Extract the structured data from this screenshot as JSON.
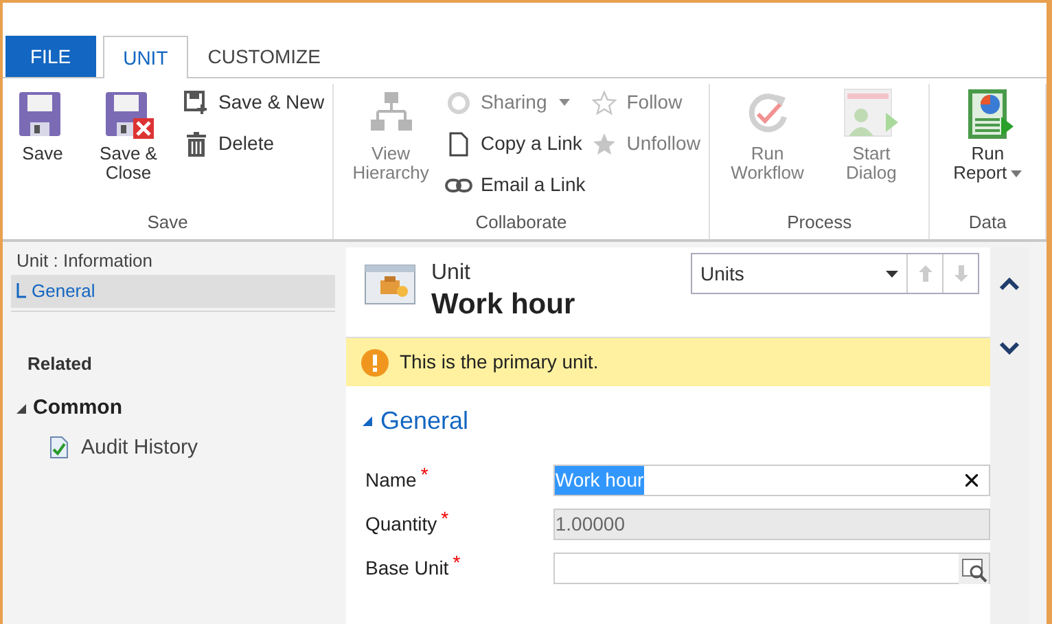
{
  "tabs": [
    {
      "label": "FILE",
      "kind": "file",
      "selected": false
    },
    {
      "label": "UNIT",
      "kind": "tab",
      "selected": true
    },
    {
      "label": "CUSTOMIZE",
      "kind": "tab",
      "selected": false
    }
  ],
  "ribbon": [
    {
      "label": "Save",
      "buttons": [
        {
          "label": "Save",
          "kind": "large",
          "disabled": false
        },
        {
          "label": "Save & Close",
          "kind": "large",
          "disabled": false
        },
        {
          "label": "Save & New",
          "kind": "small",
          "disabled": false
        },
        {
          "label": "Delete",
          "kind": "small",
          "disabled": false
        }
      ]
    },
    {
      "label": "Collaborate",
      "buttons": [
        {
          "label": "View Hierarchy",
          "kind": "large",
          "disabled": true
        },
        {
          "label": "Sharing",
          "kind": "small",
          "disabled": true,
          "dropdown": true
        },
        {
          "label": "Copy a Link",
          "kind": "small",
          "disabled": false
        },
        {
          "label": "Email a Link",
          "kind": "small",
          "disabled": false
        },
        {
          "label": "Follow",
          "kind": "small",
          "disabled": true
        },
        {
          "label": "Unfollow",
          "kind": "small",
          "disabled": true
        }
      ]
    },
    {
      "label": "Process",
      "buttons": [
        {
          "label": "Run Workflow",
          "kind": "large",
          "disabled": true
        },
        {
          "label": "Start Dialog",
          "kind": "large",
          "disabled": true
        }
      ]
    },
    {
      "label": "Data",
      "buttons": [
        {
          "label": "Run Report",
          "kind": "large",
          "disabled": false,
          "dropdown": true
        }
      ]
    }
  ],
  "nav": {
    "title": "Unit : Information",
    "items": [
      {
        "label": "General",
        "selected": true
      }
    ],
    "related": "Related",
    "groups": [
      {
        "label": "Common",
        "expanded": true,
        "children": [
          {
            "label": "Audit History"
          }
        ]
      }
    ]
  },
  "record": {
    "entity": "Unit",
    "title": "Work hour",
    "view_selector": "Units",
    "notification": "This is the primary unit.",
    "section": {
      "label": "General",
      "expanded": true
    },
    "fields": [
      {
        "label": "Name",
        "required_mark": "*",
        "value": "Work hour",
        "highlighted": true,
        "disabled": false,
        "kind": "text"
      },
      {
        "label": "Quantity",
        "required_mark": "*",
        "value": "1.00000",
        "highlighted": false,
        "disabled": true,
        "kind": "text"
      },
      {
        "label": "Base Unit",
        "required_mark": "*",
        "kind": "lookup"
      }
    ]
  }
}
